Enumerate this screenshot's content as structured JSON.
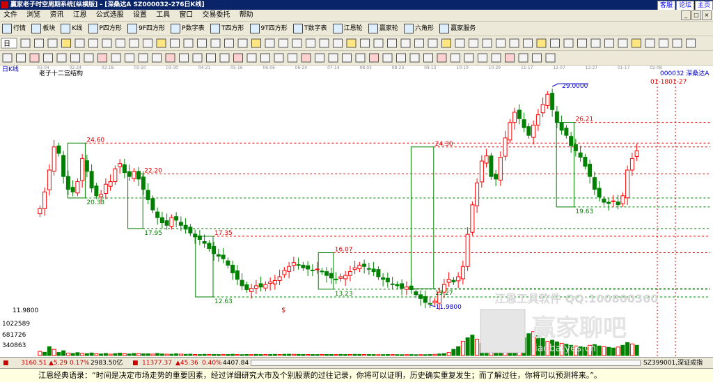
{
  "window": {
    "title": "赢家老子时空周期系统[纵横版] - [深桑达A   SZ000032-276日K线]",
    "top_buttons": [
      "客服",
      "论坛",
      "主页"
    ]
  },
  "menu": [
    "文件",
    "浏览",
    "资讯",
    "江恩",
    "公式选股",
    "设置",
    "工具",
    "窗口",
    "交易委托",
    "帮助"
  ],
  "toolbar1": [
    "行情",
    "板块",
    "K线",
    "P四方形",
    "9F四方形",
    "P数字表",
    "T四方形",
    "9T四方形",
    "T数字表",
    "江恩轮",
    "赢家轮",
    "六角形",
    "赢家服务"
  ],
  "toolbar2": {
    "period": "日"
  },
  "chart": {
    "period_label": "日K线",
    "pattern_label": "老子十二宫结构",
    "stock_label": "000032  深桑达A",
    "date_marker": "01-1801-27",
    "top_dates": [
      "03-04",
      "02-24",
      "02-18",
      "03-10",
      "03-30",
      "04-21",
      "05-16",
      "06-06",
      "06-24",
      "07-14",
      "08-03",
      "08-23",
      "09-13",
      "10-10",
      "10-29",
      "11-17",
      "12-07",
      "12-27",
      "01-17",
      "02-08"
    ],
    "watermark_1": "江恩工具软件  QQ:100800360",
    "watermark_2": "赢家聊吧",
    "watermark_3": "jiaoba.yes.cn",
    "dollar_mark": "$",
    "price_low_axis": "11.9800",
    "volume_axis": [
      "1022589",
      "681726",
      "340863"
    ],
    "colors": {
      "up": "#ff0000",
      "down": "#008000",
      "box": "#008000",
      "resist": "#dd0000"
    }
  },
  "chart_data": {
    "type": "candlestick",
    "ylim": [
      11.0,
      30.2
    ],
    "high": 29.0,
    "low": 11.98,
    "boxes": [
      {
        "top": 24.6,
        "bottom": 20.33
      },
      {
        "top": 22.2,
        "bottom": 17.95
      },
      {
        "top": 17.35,
        "bottom": 12.63
      },
      {
        "top": 16.07,
        "bottom": 13.23
      },
      {
        "top": 24.3,
        "bottom": 13.27
      },
      {
        "top": 26.21,
        "bottom": 19.63
      }
    ],
    "annotations": [
      "24.60",
      "20.33",
      "22.20",
      "17.95",
      "17.35",
      "12.63",
      "16.07",
      "13.23",
      "24.30",
      "13.27",
      "29.0000",
      "26.21",
      "19.63",
      "11.9800"
    ],
    "closes": [
      19.5,
      20.8,
      22.5,
      24.3,
      23.8,
      22.0,
      21.0,
      20.8,
      21.6,
      23.4,
      22.4,
      21.1,
      20.5,
      20.6,
      21.4,
      21.6,
      22.6,
      23.0,
      22.3,
      22.0,
      22.4,
      21.8,
      21.0,
      20.2,
      19.4,
      18.8,
      18.4,
      18.2,
      18.8,
      18.6,
      18.2,
      17.9,
      17.6,
      17.3,
      17.1,
      16.8,
      16.4,
      16.0,
      15.8,
      15.6,
      15.1,
      14.5,
      14.0,
      13.5,
      13.2,
      13.3,
      13.5,
      13.4,
      13.6,
      13.8,
      13.9,
      14.2,
      14.7,
      15.0,
      15.3,
      15.1,
      14.9,
      14.8,
      14.7,
      14.8,
      14.6,
      14.3,
      14.1,
      14.0,
      14.2,
      14.3,
      14.6,
      14.9,
      15.1,
      15.0,
      14.8,
      14.6,
      14.2,
      14.0,
      13.8,
      13.6,
      13.5,
      13.3,
      13.4,
      13.2,
      12.8,
      12.5,
      12.2,
      12.1,
      12.3,
      13.0,
      13.6,
      14.0,
      13.8,
      14.2,
      15.0,
      17.5,
      19.8,
      21.5,
      23.2,
      23.6,
      22.0,
      21.8,
      23.5,
      25.0,
      26.2,
      27.0,
      26.5,
      25.8,
      25.2,
      26.0,
      26.8,
      27.6,
      28.4,
      27.2,
      26.2,
      25.6,
      25.2,
      24.4,
      24.0,
      23.5,
      22.8,
      22.0,
      21.0,
      20.4,
      20.0,
      19.9,
      20.1,
      19.8,
      20.5,
      22.5,
      23.4,
      24.0
    ],
    "volume": [
      120000,
      95000,
      260000,
      180000,
      90000,
      140000,
      70000,
      60000,
      85000,
      60000,
      55000,
      75000,
      50000,
      45000,
      60000,
      40000,
      55000,
      70000,
      50000,
      45000,
      60000,
      55000,
      48000,
      50000,
      42000,
      60000,
      45000,
      40000,
      38000,
      50000,
      42000,
      35000,
      40000,
      30000,
      28000,
      35000,
      32000,
      30000,
      28000,
      33000,
      30000,
      36000,
      30000,
      26000,
      30000,
      28000,
      33000,
      29000,
      32000,
      30000,
      34000,
      31000,
      36000,
      38000,
      35000,
      33000,
      31000,
      30000,
      29000,
      28000,
      32000,
      31000,
      30000,
      29000,
      33000,
      30000,
      32000,
      35000,
      33000,
      31000,
      30000,
      28000,
      26000,
      27000,
      30000,
      29000,
      26000,
      25000,
      27000,
      28000,
      24000,
      26000,
      25000,
      30000,
      35000,
      45000,
      55000,
      90000,
      180000,
      260000,
      420000,
      520000,
      600000,
      480000,
      360000,
      420000,
      380000,
      450000,
      520000,
      600000,
      680000,
      560000,
      480000,
      520000,
      640000,
      700000,
      580000,
      500000,
      420000,
      450000,
      400000,
      360000,
      330000,
      300000,
      280000,
      260000,
      240000,
      300000,
      320000,
      280000,
      260000,
      240000,
      220000,
      250000,
      300000,
      380000,
      340000,
      300000
    ]
  },
  "bottom": {
    "index1": "3160.51",
    "index1_change": "▲5.29",
    "index1_pct": "0.17%",
    "index1_amount": "2983.50亿",
    "index2": "11377.37",
    "index2_change": "▲45.36",
    "index2_pct": "0.40%",
    "index2_amount": "4407.84",
    "code": "SZ399001,深证成指"
  },
  "footer": "江恩经典语录：“时间是决定市场走势的重要因素，经过详细研究大市及个别股票的过往记录，你将可以证明，历史确实重复发生；而了解过往，你将可以预测将来。”。"
}
